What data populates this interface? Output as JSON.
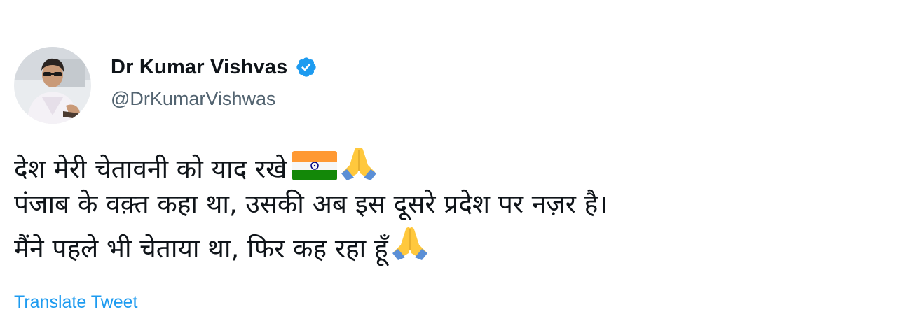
{
  "author": {
    "display_name": "Dr Kumar Vishvas",
    "handle": "@DrKumarVishwas",
    "verified": true
  },
  "tweet": {
    "lines": [
      "देश मेरी चेतावनी को याद रखे",
      "पंजाब के वक़्त कहा था, उसकी अब इस दूसरे प्रदेश पर नज़र है।",
      "मैंने पहले भी चेताया था, फिर कह रहा हूँ"
    ],
    "emoji": [
      "india-flag-icon",
      "folded-hands-icon"
    ]
  },
  "actions": {
    "translate_label": "Translate Tweet"
  },
  "colors": {
    "text": "#0f1419",
    "secondary": "#536471",
    "link": "#1d9bf0",
    "verified": "#1d9bf0",
    "flag_saffron": "#ff9933",
    "flag_green": "#138808",
    "chakra": "#000080"
  }
}
